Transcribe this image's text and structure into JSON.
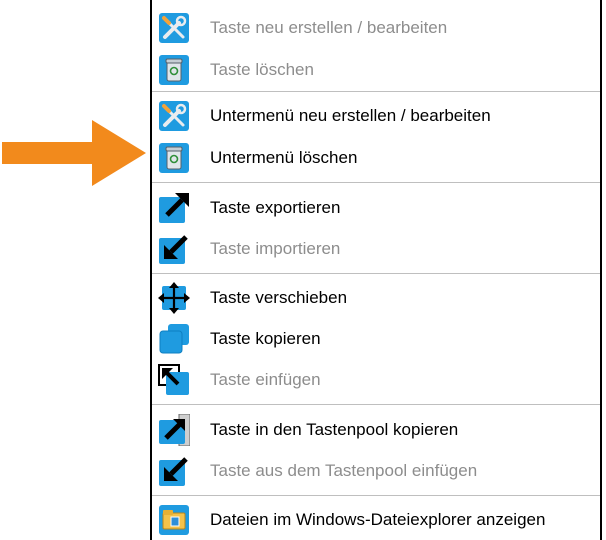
{
  "menu": {
    "items": [
      {
        "label": "Taste neu erstellen / bearbeiten",
        "enabled": false,
        "icon": "tools-icon"
      },
      {
        "label": "Taste löschen",
        "enabled": false,
        "icon": "recycle-bin-icon"
      },
      {
        "label": "Untermenü neu erstellen / bearbeiten",
        "enabled": true,
        "icon": "tools-icon"
      },
      {
        "label": "Untermenü löschen",
        "enabled": true,
        "icon": "recycle-bin-icon"
      },
      {
        "label": "Taste exportieren",
        "enabled": true,
        "icon": "export-arrow-icon"
      },
      {
        "label": "Taste importieren",
        "enabled": false,
        "icon": "import-arrow-icon"
      },
      {
        "label": "Taste verschieben",
        "enabled": true,
        "icon": "move-arrows-icon"
      },
      {
        "label": "Taste kopieren",
        "enabled": true,
        "icon": "copy-icon"
      },
      {
        "label": "Taste einfügen",
        "enabled": false,
        "icon": "paste-icon"
      },
      {
        "label": "Taste in den Tastenpool kopieren",
        "enabled": true,
        "icon": "copy-to-pool-icon"
      },
      {
        "label": "Taste aus dem Tastenpool einfügen",
        "enabled": false,
        "icon": "paste-from-pool-icon"
      },
      {
        "label": "Dateien im Windows-Dateiexplorer anzeigen",
        "enabled": true,
        "icon": "file-explorer-icon"
      }
    ]
  },
  "colors": {
    "accent_blue": "#1f9be0",
    "pointer_arrow": "#f28a1c",
    "disabled_text": "#8d8d8d"
  }
}
